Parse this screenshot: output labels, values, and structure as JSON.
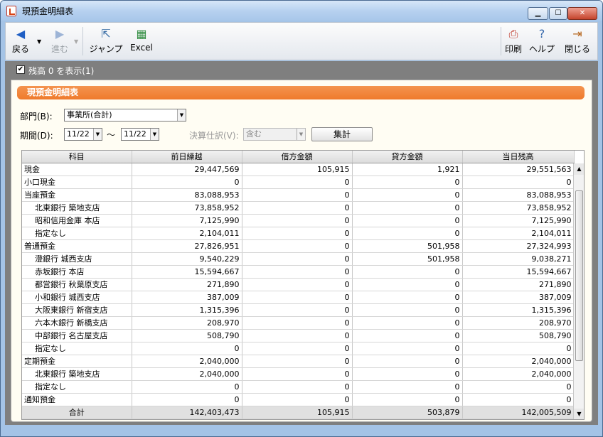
{
  "window": {
    "title": "現預金明細表"
  },
  "toolbar": {
    "back": "戻る",
    "forward": "進む",
    "jump": "ジャンプ",
    "excel": "Excel",
    "print": "印刷",
    "help": "ヘルプ",
    "close": "閉じる"
  },
  "options": {
    "show_zero_balance": "残高 0 を表示(1)",
    "show_zero_checked": true
  },
  "section": {
    "title": "現預金明細表"
  },
  "filters": {
    "department_label": "部門(B):",
    "department_value": "事業所(合計)",
    "period_label": "期間(D):",
    "period_from": "11/22",
    "period_sep": "～",
    "period_to": "11/22",
    "closing_label": "決算仕訳(V):",
    "closing_value": "含む",
    "aggregate_button": "集計"
  },
  "table": {
    "headers": [
      "科目",
      "前日繰越",
      "借方金額",
      "貸方金額",
      "当日残高"
    ],
    "rows": [
      {
        "account": "現金",
        "sub": false,
        "prev": "29,447,569",
        "debit": "105,915",
        "credit": "1,921",
        "balance": "29,551,563"
      },
      {
        "account": "小口現金",
        "sub": false,
        "prev": "0",
        "debit": "0",
        "credit": "0",
        "balance": "0"
      },
      {
        "account": "当座預金",
        "sub": false,
        "prev": "83,088,953",
        "debit": "0",
        "credit": "0",
        "balance": "83,088,953"
      },
      {
        "account": "北東銀行 築地支店",
        "sub": true,
        "prev": "73,858,952",
        "debit": "0",
        "credit": "0",
        "balance": "73,858,952"
      },
      {
        "account": "昭和信用金庫 本店",
        "sub": true,
        "prev": "7,125,990",
        "debit": "0",
        "credit": "0",
        "balance": "7,125,990"
      },
      {
        "account": "指定なし",
        "sub": true,
        "prev": "2,104,011",
        "debit": "0",
        "credit": "0",
        "balance": "2,104,011"
      },
      {
        "account": "普通預金",
        "sub": false,
        "prev": "27,826,951",
        "debit": "0",
        "credit": "501,958",
        "balance": "27,324,993"
      },
      {
        "account": "澄銀行 城西支店",
        "sub": true,
        "prev": "9,540,229",
        "debit": "0",
        "credit": "501,958",
        "balance": "9,038,271"
      },
      {
        "account": "赤坂銀行 本店",
        "sub": true,
        "prev": "15,594,667",
        "debit": "0",
        "credit": "0",
        "balance": "15,594,667"
      },
      {
        "account": "都営銀行 秋葉原支店",
        "sub": true,
        "prev": "271,890",
        "debit": "0",
        "credit": "0",
        "balance": "271,890"
      },
      {
        "account": "小和銀行 城西支店",
        "sub": true,
        "prev": "387,009",
        "debit": "0",
        "credit": "0",
        "balance": "387,009"
      },
      {
        "account": "大阪東銀行 新宿支店",
        "sub": true,
        "prev": "1,315,396",
        "debit": "0",
        "credit": "0",
        "balance": "1,315,396"
      },
      {
        "account": "六本木銀行 新橋支店",
        "sub": true,
        "prev": "208,970",
        "debit": "0",
        "credit": "0",
        "balance": "208,970"
      },
      {
        "account": "中部銀行 名古屋支店",
        "sub": true,
        "prev": "508,790",
        "debit": "0",
        "credit": "0",
        "balance": "508,790"
      },
      {
        "account": "指定なし",
        "sub": true,
        "prev": "0",
        "debit": "0",
        "credit": "0",
        "balance": "0"
      },
      {
        "account": "定期預金",
        "sub": false,
        "prev": "2,040,000",
        "debit": "0",
        "credit": "0",
        "balance": "2,040,000"
      },
      {
        "account": "北東銀行 築地支店",
        "sub": true,
        "prev": "2,040,000",
        "debit": "0",
        "credit": "0",
        "balance": "2,040,000"
      },
      {
        "account": "指定なし",
        "sub": true,
        "prev": "0",
        "debit": "0",
        "credit": "0",
        "balance": "0"
      },
      {
        "account": "通知預金",
        "sub": false,
        "prev": "0",
        "debit": "0",
        "credit": "0",
        "balance": "0"
      }
    ],
    "total": {
      "account": "合計",
      "prev": "142,403,473",
      "debit": "105,915",
      "credit": "503,879",
      "balance": "142,005,509"
    }
  }
}
